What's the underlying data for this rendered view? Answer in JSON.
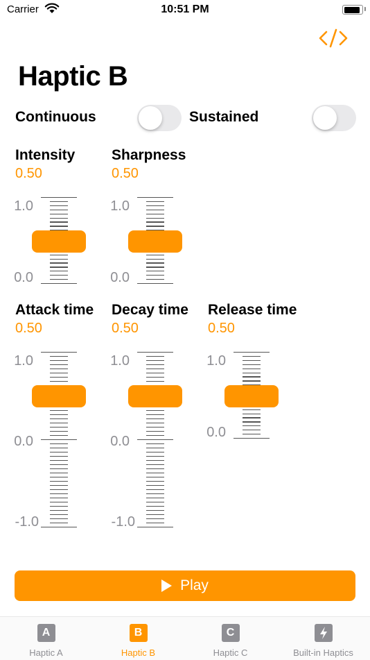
{
  "status": {
    "carrier": "Carrier",
    "time": "10:51 PM"
  },
  "header": {
    "title": "Haptic B",
    "code_icon": "code-brackets-icon"
  },
  "toggles": [
    {
      "label": "Continuous",
      "on": false
    },
    {
      "label": "Sustained",
      "on": false
    }
  ],
  "params": {
    "intensity": {
      "label": "Intensity",
      "value": "0.50"
    },
    "sharpness": {
      "label": "Sharpness",
      "value": "0.50"
    },
    "attack": {
      "label": "Attack time",
      "value": "0.50"
    },
    "decay": {
      "label": "Decay time",
      "value": "0.50"
    },
    "release": {
      "label": "Release time",
      "value": "0.50"
    }
  },
  "scales": {
    "max": "1.0",
    "mid": "0.0",
    "min": "-1.0"
  },
  "play": {
    "label": "Play"
  },
  "tabs": [
    {
      "label": "Haptic A",
      "icon_letter": "A",
      "selected": false
    },
    {
      "label": "Haptic B",
      "icon_letter": "B",
      "selected": true
    },
    {
      "label": "Haptic C",
      "icon_letter": "C",
      "selected": false
    },
    {
      "label": "Built-in Haptics",
      "icon": "lightning-icon",
      "selected": false
    }
  ],
  "colors": {
    "accent": "#ff9500",
    "inactive": "#8e8e93"
  }
}
